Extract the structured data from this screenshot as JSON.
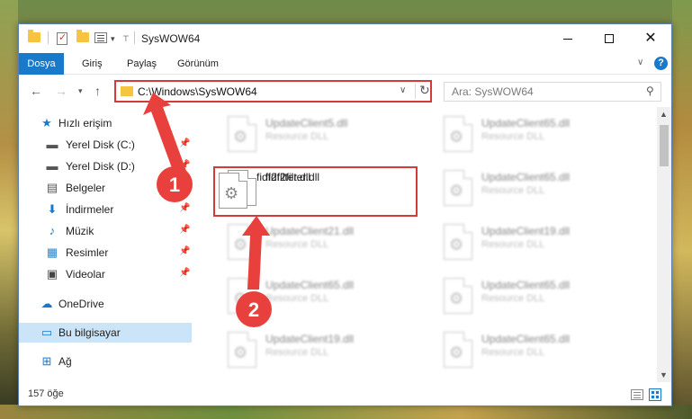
{
  "window": {
    "title": "SysWOW64"
  },
  "ribbon": {
    "tabs": [
      "Dosya",
      "Giriş",
      "Paylaş",
      "Görünüm"
    ],
    "help": "?"
  },
  "address": {
    "path": "C:\\Windows\\SysWOW64",
    "search_placeholder": "Ara: SysWOW64"
  },
  "nav": {
    "items": [
      {
        "label": "Hızlı erişim",
        "icon": "star-icon",
        "pinned": false
      },
      {
        "label": "Yerel Disk (C:)",
        "icon": "drive-icon",
        "pinned": true
      },
      {
        "label": "Yerel Disk (D:)",
        "icon": "drive-icon",
        "pinned": true
      },
      {
        "label": "Belgeler",
        "icon": "documents-icon",
        "pinned": true
      },
      {
        "label": "İndirmeler",
        "icon": "download-icon",
        "pinned": true
      },
      {
        "label": "Müzik",
        "icon": "music-icon",
        "pinned": true
      },
      {
        "label": "Resimler",
        "icon": "pictures-icon",
        "pinned": true
      },
      {
        "label": "Videolar",
        "icon": "video-icon",
        "pinned": true
      },
      {
        "label": "OneDrive",
        "icon": "cloud-icon",
        "pinned": false
      },
      {
        "label": "Bu bilgisayar",
        "icon": "computer-icon",
        "pinned": false
      },
      {
        "label": "Ağ",
        "icon": "network-icon",
        "pinned": false
      }
    ]
  },
  "files": [
    {
      "name": "UpdateClient5.dll",
      "type": "Resource DLL"
    },
    {
      "name": "UpdateClient65.dll",
      "type": "Resource DLL"
    },
    {
      "name": "fidf2filter.dll",
      "type": ""
    },
    {
      "name": "UpdateClient65.dll",
      "type": "Resource DLL"
    },
    {
      "name": "UpdateClient21.dll",
      "type": "Resource DLL"
    },
    {
      "name": "UpdateClient19.dll",
      "type": "Resource DLL"
    },
    {
      "name": "UpdateClient65.dll",
      "type": "Resource DLL"
    },
    {
      "name": "UpdateClient65.dll",
      "type": "Resource DLL"
    },
    {
      "name": "UpdateClient19.dll",
      "type": "Resource DLL"
    },
    {
      "name": "UpdateClient65.dll",
      "type": "Resource DLL"
    }
  ],
  "status": {
    "count": "157 öğe"
  },
  "annotations": {
    "step1": "1",
    "step2": "2",
    "color": "#e8413d"
  }
}
